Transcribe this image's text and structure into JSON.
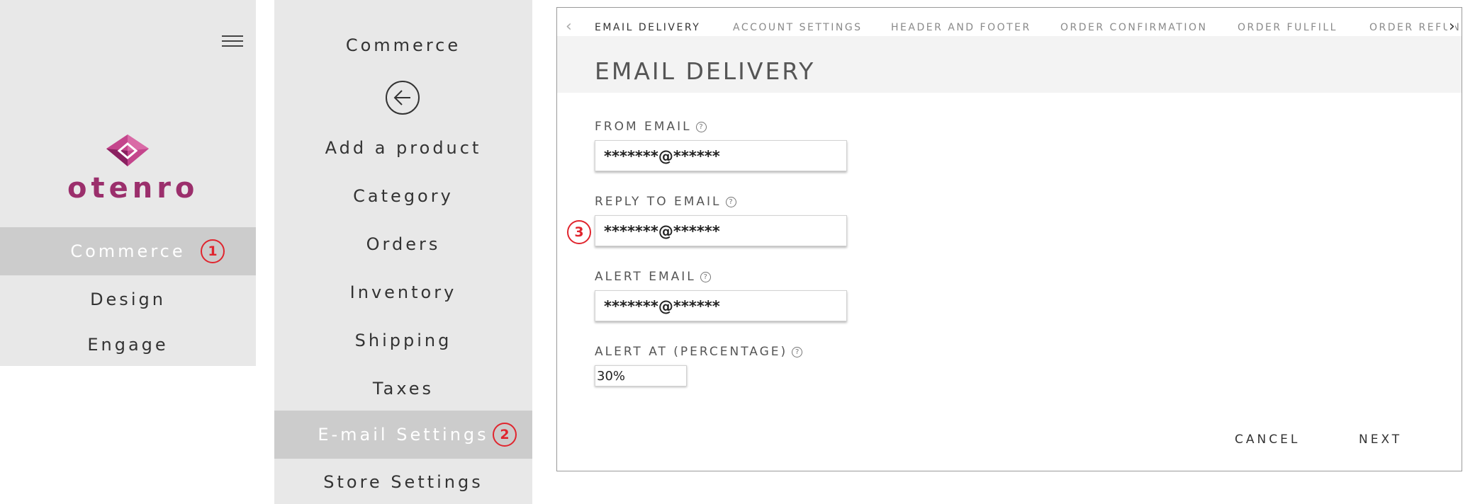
{
  "left_nav": {
    "logo_text": "otenro",
    "items": [
      {
        "label": "Commerce",
        "active": true,
        "badge": "1"
      },
      {
        "label": "Design",
        "active": false
      },
      {
        "label": "Engage",
        "active": false
      }
    ]
  },
  "commerce_menu": {
    "title": "Commerce",
    "items": [
      {
        "label": "Add a product",
        "active": false
      },
      {
        "label": "Category",
        "active": false
      },
      {
        "label": "Orders",
        "active": false
      },
      {
        "label": "Inventory",
        "active": false
      },
      {
        "label": "Shipping",
        "active": false
      },
      {
        "label": "Taxes",
        "active": false
      },
      {
        "label": "E-mail Settings",
        "active": true,
        "badge": "2"
      },
      {
        "label": "Store Settings",
        "active": false
      }
    ]
  },
  "tabs": [
    {
      "label": "EMAIL DELIVERY",
      "active": true
    },
    {
      "label": "ACCOUNT SETTINGS",
      "active": false
    },
    {
      "label": "HEADER AND FOOTER",
      "active": false
    },
    {
      "label": "ORDER CONFIRMATION",
      "active": false
    },
    {
      "label": "ORDER FULFILL",
      "active": false
    },
    {
      "label": "ORDER REFUN",
      "active": false
    }
  ],
  "form": {
    "title": "EMAIL DELIVERY",
    "fields": [
      {
        "label": "FROM EMAIL",
        "value": "*******@******"
      },
      {
        "label": "REPLY TO EMAIL",
        "value": "*******@******",
        "badge": "3"
      },
      {
        "label": "ALERT EMAIL",
        "value": "*******@******"
      },
      {
        "label": "ALERT AT (PERCENTAGE)",
        "value": "30%"
      }
    ],
    "help_glyph": "?",
    "cancel_label": "CANCEL",
    "next_label": "NEXT"
  },
  "colors": {
    "panel_bg": "#e8e8e8",
    "active_bg": "#cccccc",
    "badge_red": "#e0252e",
    "brand_magenta": "#9b2f6c"
  },
  "icons": [
    "hamburger-icon",
    "back-arrow-icon",
    "chevron-left-icon",
    "chevron-right-icon",
    "help-icon"
  ]
}
